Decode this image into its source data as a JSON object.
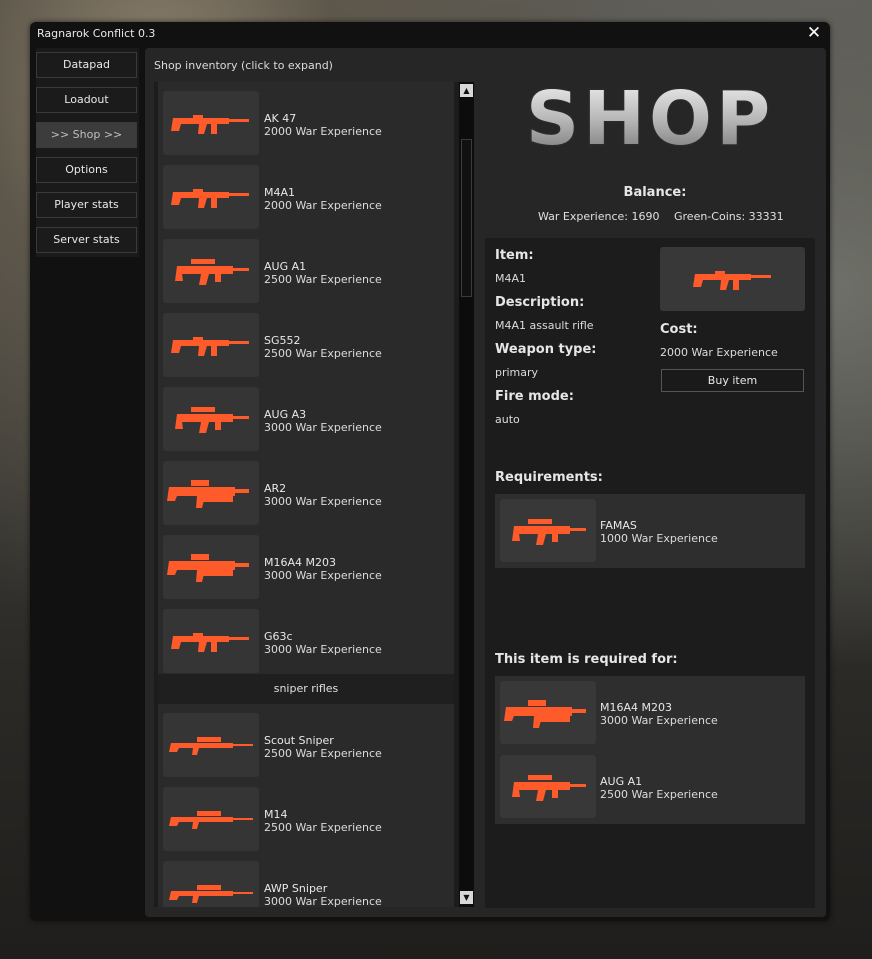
{
  "window": {
    "title": "Ragnarok Conflict 0.3",
    "close_glyph": "✕"
  },
  "nav": [
    {
      "label": "Datapad",
      "active": false
    },
    {
      "label": "Loadout",
      "active": false
    },
    {
      "label": ">> Shop >>",
      "active": true
    },
    {
      "label": "Options",
      "active": false
    },
    {
      "label": "Player stats",
      "active": false
    },
    {
      "label": "Server stats",
      "active": false
    }
  ],
  "inventory": {
    "title": "Shop inventory (click to expand)",
    "items": [
      {
        "name": "AK 47",
        "cost": "2000 War Experience",
        "icon": "ak47-icon"
      },
      {
        "name": "M4A1",
        "cost": "2000 War Experience",
        "icon": "m4a1-icon"
      },
      {
        "name": "AUG A1",
        "cost": "2500 War Experience",
        "icon": "aug-a1-icon"
      },
      {
        "name": "SG552",
        "cost": "2500 War Experience",
        "icon": "sg552-icon"
      },
      {
        "name": "AUG A3",
        "cost": "3000 War Experience",
        "icon": "aug-a3-icon"
      },
      {
        "name": "AR2",
        "cost": "3000 War Experience",
        "icon": "ar2-icon"
      },
      {
        "name": "M16A4 M203",
        "cost": "3000 War Experience",
        "icon": "m16a4-icon"
      },
      {
        "name": "G63c",
        "cost": "3000 War Experience",
        "icon": "g63c-icon"
      }
    ],
    "category": "sniper rifles",
    "snipers": [
      {
        "name": "Scout Sniper",
        "cost": "2500 War Experience",
        "icon": "scout-sniper-icon"
      },
      {
        "name": "M14",
        "cost": "2500 War Experience",
        "icon": "m14-icon"
      },
      {
        "name": "AWP Sniper",
        "cost": "3000 War Experience",
        "icon": "awp-sniper-icon"
      }
    ]
  },
  "shop": {
    "logo_text": "SHOP",
    "balance_label": "Balance:",
    "war_experience": "War Experience: 1690",
    "green_coins": "Green-Coins: 33331"
  },
  "detail": {
    "item_label": "Item:",
    "item_value": "M4A1",
    "description_label": "Description:",
    "description_value": "M4A1 assault rifle",
    "weapon_type_label": "Weapon type:",
    "weapon_type_value": "primary",
    "fire_mode_label": "Fire mode:",
    "fire_mode_value": "auto",
    "cost_label": "Cost:",
    "cost_value": "2000 War Experience",
    "buy_label": "Buy item",
    "requirements_label": "Requirements:",
    "requirements": [
      {
        "name": "FAMAS",
        "cost": "1000 War Experience"
      }
    ],
    "required_for_label": "This item is required for:",
    "required_for": [
      {
        "name": "M16A4 M203",
        "cost": "3000 War Experience"
      },
      {
        "name": "AUG A1",
        "cost": "2500 War Experience"
      }
    ]
  },
  "colors": {
    "weapon": "#ff5a2a",
    "panel": "#262626",
    "window": "#111111"
  }
}
